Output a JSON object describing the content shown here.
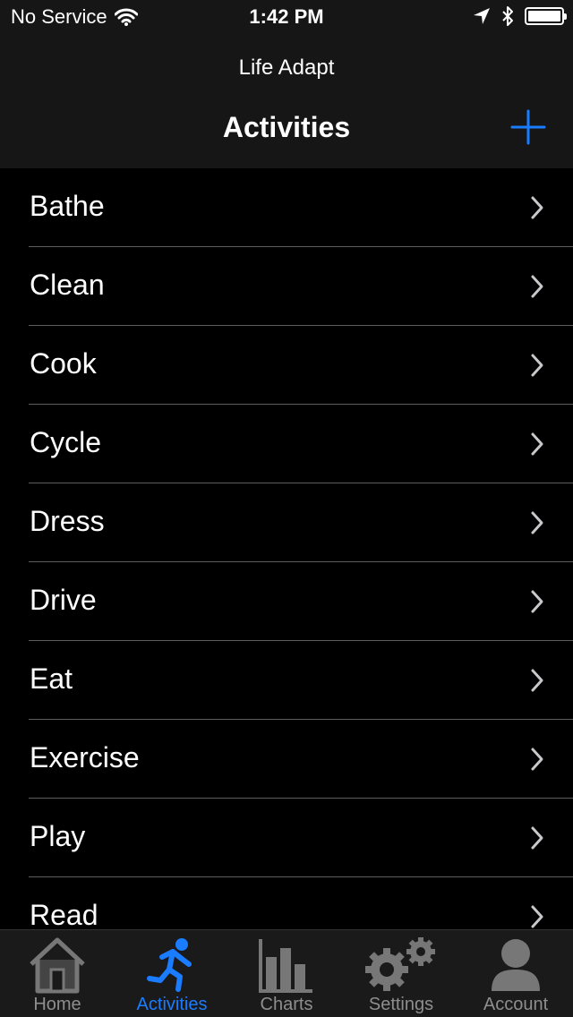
{
  "status": {
    "carrier": "No Service",
    "time": "1:42 PM"
  },
  "nav": {
    "app_name": "Life Adapt",
    "title": "Activities",
    "add_icon": "plus-icon"
  },
  "activities": [
    {
      "label": "Bathe"
    },
    {
      "label": "Clean"
    },
    {
      "label": "Cook"
    },
    {
      "label": "Cycle"
    },
    {
      "label": "Dress"
    },
    {
      "label": "Drive"
    },
    {
      "label": "Eat"
    },
    {
      "label": "Exercise"
    },
    {
      "label": "Play"
    },
    {
      "label": "Read"
    }
  ],
  "tabs": [
    {
      "label": "Home",
      "icon": "home-icon"
    },
    {
      "label": "Activities",
      "icon": "runner-icon",
      "active": true
    },
    {
      "label": "Charts",
      "icon": "bar-chart-icon"
    },
    {
      "label": "Settings",
      "icon": "gears-icon"
    },
    {
      "label": "Account",
      "icon": "person-icon"
    }
  ],
  "colors": {
    "accent": "#1a7cff",
    "bar_background": "#161616",
    "background": "#000000",
    "separator": "#5c5c5c",
    "inactive_tab": "#8e8e8e"
  }
}
